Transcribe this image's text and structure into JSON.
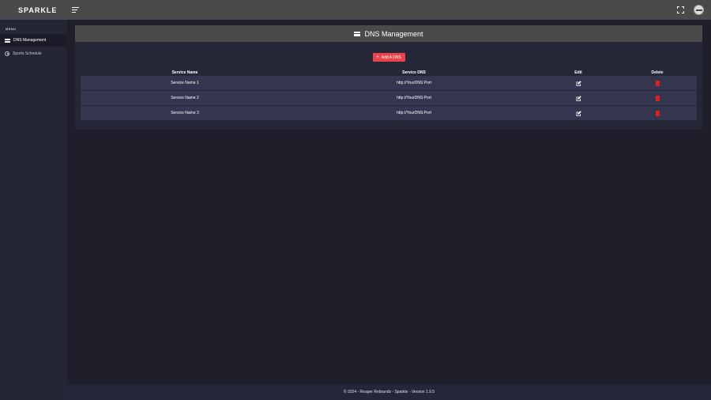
{
  "app": {
    "brand": "SPARKLE"
  },
  "sidebar": {
    "menu_title": "MENU",
    "items": [
      {
        "label": "DNS Management",
        "icon": "server-icon",
        "active": true
      },
      {
        "label": "Sports Schedule",
        "icon": "clock-icon",
        "active": false
      }
    ]
  },
  "main": {
    "title": "DNS Management",
    "add_button_label": "Add A DNS",
    "table": {
      "headers": [
        "Service Name",
        "Service DNS",
        "Edit",
        "Delete"
      ],
      "rows": [
        {
          "service_name": "Service Name 1",
          "service_dns": "http://YourDNS:Port"
        },
        {
          "service_name": "Service Name 2",
          "service_dns": "http://YourDNS:Port"
        },
        {
          "service_name": "Service Name 3",
          "service_dns": "http://YourDNS:Port"
        }
      ]
    }
  },
  "footer": {
    "text": "© 2024 - Reaper Rebrands - Sparkle - Version 1.9.5"
  },
  "colors": {
    "background": "#1e1f2b",
    "topbar": "#4a4a4a",
    "sidebar": "#242636",
    "row": "#343650",
    "accent_button": "#e8444a",
    "delete": "#e41e1e"
  }
}
